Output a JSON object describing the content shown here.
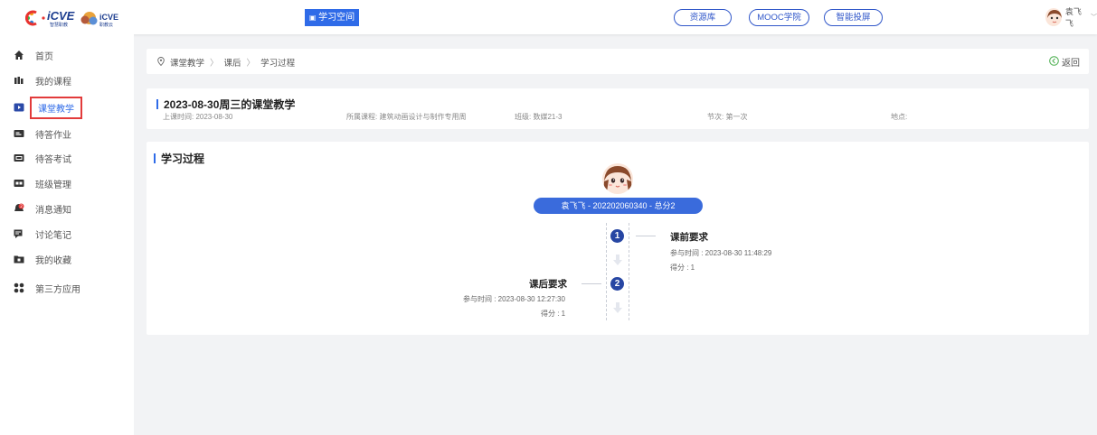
{
  "header": {
    "logo_text_1": "iCVE",
    "logo_sub_1": "智慧职教",
    "logo_text_2": "iCVE",
    "logo_sub_2": "职教云",
    "learning_space": "学习空间",
    "nav_pills": [
      "资源库",
      "MOOC学院",
      "智能投屏"
    ],
    "user_name": "袁飞飞",
    "user_chevron": "chevron-down-icon"
  },
  "sidebar": {
    "items": [
      {
        "label": "首页",
        "icon": "home-icon"
      },
      {
        "label": "我的课程",
        "icon": "books-icon"
      },
      {
        "label": "课堂教学",
        "icon": "play-icon",
        "active": true
      },
      {
        "label": "待答作业",
        "icon": "homework-icon"
      },
      {
        "label": "待答考试",
        "icon": "exam-icon"
      },
      {
        "label": "班级管理",
        "icon": "class-icon"
      },
      {
        "label": "消息通知",
        "icon": "bell-icon"
      },
      {
        "label": "讨论笔记",
        "icon": "chat-icon"
      },
      {
        "label": "我的收藏",
        "icon": "folder-icon"
      },
      {
        "label": "第三方应用",
        "icon": "apps-icon"
      }
    ]
  },
  "breadcrumb": {
    "items": [
      "课堂教学",
      "课后",
      "学习过程"
    ],
    "back_label": "返回"
  },
  "lesson": {
    "title": "2023-08-30周三的课堂教学",
    "time": "上课时间: 2023-08-30",
    "course": "所属课程: 建筑动画设计与制作专用周",
    "class": "班级: 数媒21-3",
    "section": "节次: 第一次",
    "location": "地点:"
  },
  "process": {
    "title": "学习过程",
    "student_banner": "袁飞飞 - 202202060340 - 总分2",
    "steps": [
      {
        "num": "1",
        "title": "课前要求",
        "time": "参与时间 : 2023-08-30 11:48:29",
        "score": "得分 : 1"
      },
      {
        "num": "2",
        "title": "课后要求",
        "time": "参与时间 : 2023-08-30 12:27:30",
        "score": "得分 : 1"
      }
    ]
  },
  "colors": {
    "accent": "#2f6be8",
    "banner": "#3a6bdc",
    "step": "#2746a3",
    "active_border": "#e23b3b"
  }
}
